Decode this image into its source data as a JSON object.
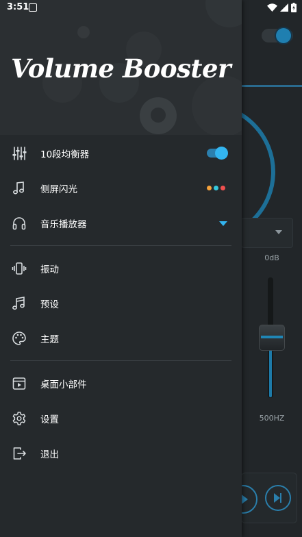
{
  "status": {
    "time": "3:51"
  },
  "drawer": {
    "brand": "Volume Booster",
    "sections": [
      [
        {
          "label": "10段均衡器",
          "icon": "equalizer-sliders-icon",
          "control": "toggle",
          "on": true
        },
        {
          "label": "侧屏闪光",
          "icon": "music-note-icon",
          "control": "color-dots"
        },
        {
          "label": "音乐播放器",
          "icon": "headphones-icon",
          "control": "expand-caret"
        }
      ],
      [
        {
          "label": "振动",
          "icon": "vibrate-phone-icon"
        },
        {
          "label": "预设",
          "icon": "music-notes-icon"
        },
        {
          "label": "主题",
          "icon": "palette-icon"
        }
      ],
      [
        {
          "label": "桌面小部件",
          "icon": "widget-player-icon"
        },
        {
          "label": "设置",
          "icon": "gear-icon"
        },
        {
          "label": "退出",
          "icon": "exit-icon"
        }
      ]
    ]
  },
  "background_app": {
    "gain_label": "0dB",
    "band_label": "500HZ"
  },
  "colors": {
    "accent": "#33b5f0",
    "drawer_bg": "#25292c",
    "dot_orange": "#f5a23b",
    "dot_cyan": "#34c8dc",
    "dot_red": "#f0504f"
  }
}
